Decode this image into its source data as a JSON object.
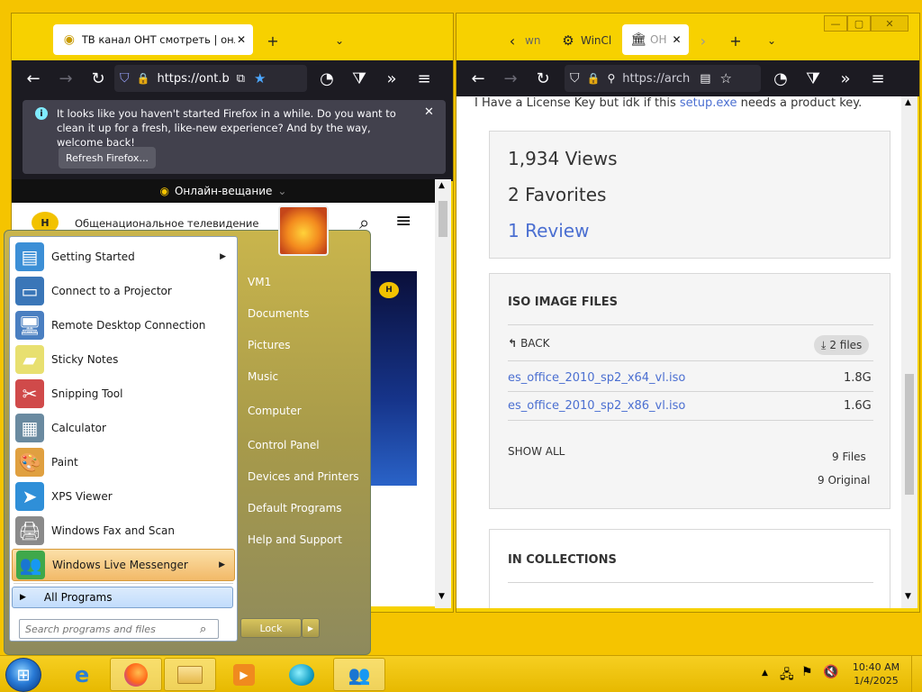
{
  "left_window": {
    "tab_title": "ТВ канал ОНТ смотреть | онла",
    "url": "https://ont.b",
    "notification": {
      "text": "It looks like you haven't started Firefox in a while. Do you want to clean it up for a fresh, like-new experience? And by the way, welcome back!",
      "button_label": "Refresh Firefox..."
    },
    "live_label": "Онлайн-вещание",
    "site_name": "Общенациональное телевидение"
  },
  "right_window": {
    "tabs": [
      {
        "label": "wn"
      },
      {
        "label": "WinCl"
      },
      {
        "label": "OH"
      }
    ],
    "url": "https://arch",
    "top_text_before": "I Have a License Key but idk if this ",
    "top_text_link": "setup.exe",
    "top_text_after": " needs a product key.",
    "stats": {
      "views": "1,934 Views",
      "favorites": "2 Favorites",
      "reviews": "1 Review"
    },
    "iso": {
      "heading": "ISO IMAGE FILES",
      "back_label": "BACK",
      "files_badge": "2 files",
      "files": [
        {
          "name": "es_office_2010_sp2_x64_vl.iso",
          "size": "1.8G"
        },
        {
          "name": "es_office_2010_sp2_x86_vl.iso",
          "size": "1.6G"
        }
      ],
      "show_all": "SHOW ALL",
      "count_files": "9 Files",
      "count_original": "9 Original"
    },
    "collections_heading": "IN COLLECTIONS"
  },
  "start_menu": {
    "programs": [
      {
        "label": "Getting Started",
        "icon": "getting-started-icon",
        "glyph": "▤",
        "color": "#3c8fd6",
        "arrow": true
      },
      {
        "label": "Connect to a Projector",
        "icon": "projector-icon",
        "glyph": "▭",
        "color": "#3a76b8",
        "arrow": false
      },
      {
        "label": "Remote Desktop Connection",
        "icon": "remote-desktop-icon",
        "glyph": "🖥",
        "color": "#4a7fc1",
        "arrow": false
      },
      {
        "label": "Sticky Notes",
        "icon": "sticky-notes-icon",
        "glyph": "▰",
        "color": "#e8e070",
        "arrow": false
      },
      {
        "label": "Snipping Tool",
        "icon": "scissors-icon",
        "glyph": "✂",
        "color": "#d04a4a",
        "arrow": false
      },
      {
        "label": "Calculator",
        "icon": "calculator-icon",
        "glyph": "▦",
        "color": "#6a8aa0",
        "arrow": false
      },
      {
        "label": "Paint",
        "icon": "paint-icon",
        "glyph": "🎨",
        "color": "#e0a040",
        "arrow": false
      },
      {
        "label": "XPS Viewer",
        "icon": "xps-viewer-icon",
        "glyph": "➤",
        "color": "#2f8fd8",
        "arrow": false
      },
      {
        "label": "Windows Fax and Scan",
        "icon": "fax-icon",
        "glyph": "🖨",
        "color": "#8a8a8a",
        "arrow": false
      },
      {
        "label": "Windows Live Messenger",
        "icon": "messenger-icon",
        "glyph": "👥",
        "color": "#3fa84a",
        "arrow": true
      }
    ],
    "all_programs": "All Programs",
    "search_placeholder": "Search programs and files",
    "right_items": [
      "VM1",
      "Documents",
      "Pictures",
      "Music",
      "Computer",
      "Control Panel",
      "Devices and Printers",
      "Default Programs",
      "Help and Support"
    ],
    "lock_label": "Lock"
  },
  "taskbar": {
    "time": "10:40 AM",
    "date": "1/4/2025"
  }
}
